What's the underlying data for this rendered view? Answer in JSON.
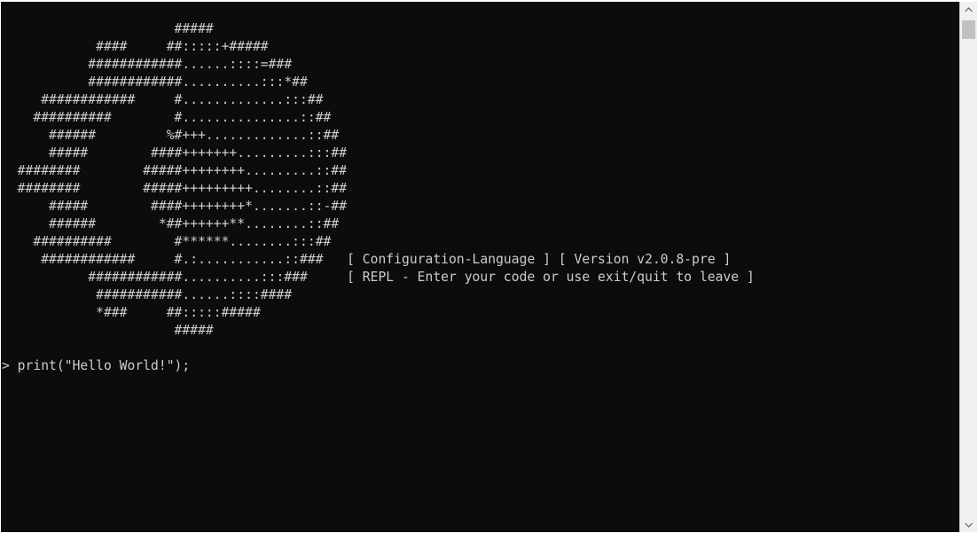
{
  "console": {
    "lines": [
      "                      #####",
      "            ####     ##:::::+#####",
      "           ############......::::=###",
      "           ############..........:::*##",
      "     ############     #.............:::##",
      "    ##########        #...............::##",
      "      ######         %#+++.............::##",
      "      #####        ####+++++++.........:::##",
      "  ########        #####++++++++.........::##",
      "  ########        #####+++++++++........::##",
      "      #####        ####++++++++*.......::-##",
      "      ######        *##++++++**........::##",
      "    ##########        #******........:::##",
      "     ############     #.:...........::###   [ Configuration-Language ] [ Version v2.0.8-pre ]",
      "           ############..........:::###     [ REPL - Enter your code or use exit/quit to leave ]",
      "            ###########......::::####",
      "            *###     ##:::::#####",
      "                      #####",
      "",
      "> print(\"Hello World!\");"
    ]
  },
  "scrollbar": {
    "up_icon": "scroll-up-arrow-icon",
    "down_icon": "scroll-down-arrow-icon"
  },
  "colors": {
    "background": "#0c0c0c",
    "text": "#cccccc",
    "scrollbar_track": "#f0f0f0",
    "scrollbar_thumb": "#c1c1c1"
  }
}
